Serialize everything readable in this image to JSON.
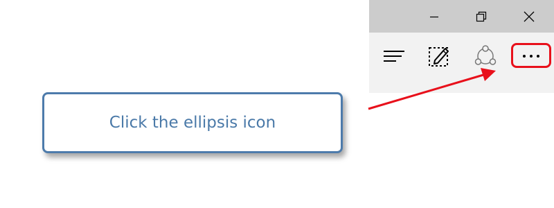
{
  "window_controls": {
    "minimize_icon": "minimize-icon",
    "restore_icon": "restore-icon",
    "close_icon": "close-icon"
  },
  "toolbar": {
    "items": [
      {
        "icon": "hub-icon"
      },
      {
        "icon": "web-note-icon"
      },
      {
        "icon": "share-icon"
      },
      {
        "icon": "ellipsis-icon"
      }
    ]
  },
  "callout": {
    "text": "Click the ellipsis icon"
  },
  "colors": {
    "highlight": "#e8101b",
    "callout_border": "#4d7bab",
    "callout_text": "#4a79a8",
    "titlebar": "#cccccc",
    "toolbar": "#f2f2f2"
  }
}
